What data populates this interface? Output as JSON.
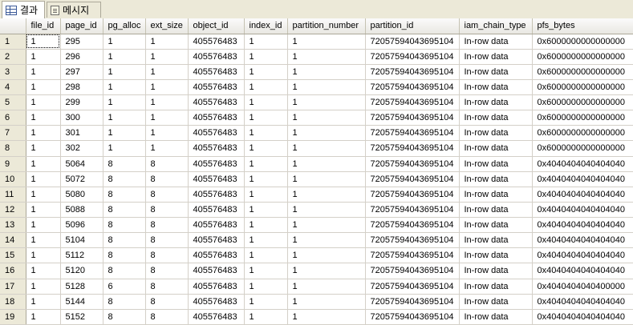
{
  "tabs": [
    {
      "label": "결과",
      "icon": "grid-icon",
      "active": true
    },
    {
      "label": "메시지",
      "icon": "message-doc-icon",
      "active": false
    }
  ],
  "columns": [
    "file_id",
    "page_id",
    "pg_alloc",
    "ext_size",
    "object_id",
    "index_id",
    "partition_number",
    "partition_id",
    "iam_chain_type",
    "pfs_bytes"
  ],
  "rows": [
    {
      "n": "1",
      "c": [
        "1",
        "295",
        "1",
        "1",
        "405576483",
        "1",
        "1",
        "72057594043695104",
        "In-row data",
        "0x6000000000000000"
      ]
    },
    {
      "n": "2",
      "c": [
        "1",
        "296",
        "1",
        "1",
        "405576483",
        "1",
        "1",
        "72057594043695104",
        "In-row data",
        "0x6000000000000000"
      ]
    },
    {
      "n": "3",
      "c": [
        "1",
        "297",
        "1",
        "1",
        "405576483",
        "1",
        "1",
        "72057594043695104",
        "In-row data",
        "0x6000000000000000"
      ]
    },
    {
      "n": "4",
      "c": [
        "1",
        "298",
        "1",
        "1",
        "405576483",
        "1",
        "1",
        "72057594043695104",
        "In-row data",
        "0x6000000000000000"
      ]
    },
    {
      "n": "5",
      "c": [
        "1",
        "299",
        "1",
        "1",
        "405576483",
        "1",
        "1",
        "72057594043695104",
        "In-row data",
        "0x6000000000000000"
      ]
    },
    {
      "n": "6",
      "c": [
        "1",
        "300",
        "1",
        "1",
        "405576483",
        "1",
        "1",
        "72057594043695104",
        "In-row data",
        "0x6000000000000000"
      ]
    },
    {
      "n": "7",
      "c": [
        "1",
        "301",
        "1",
        "1",
        "405576483",
        "1",
        "1",
        "72057594043695104",
        "In-row data",
        "0x6000000000000000"
      ]
    },
    {
      "n": "8",
      "c": [
        "1",
        "302",
        "1",
        "1",
        "405576483",
        "1",
        "1",
        "72057594043695104",
        "In-row data",
        "0x6000000000000000"
      ]
    },
    {
      "n": "9",
      "c": [
        "1",
        "5064",
        "8",
        "8",
        "405576483",
        "1",
        "1",
        "72057594043695104",
        "In-row data",
        "0x4040404040404040"
      ]
    },
    {
      "n": "10",
      "c": [
        "1",
        "5072",
        "8",
        "8",
        "405576483",
        "1",
        "1",
        "72057594043695104",
        "In-row data",
        "0x4040404040404040"
      ]
    },
    {
      "n": "11",
      "c": [
        "1",
        "5080",
        "8",
        "8",
        "405576483",
        "1",
        "1",
        "72057594043695104",
        "In-row data",
        "0x4040404040404040"
      ]
    },
    {
      "n": "12",
      "c": [
        "1",
        "5088",
        "8",
        "8",
        "405576483",
        "1",
        "1",
        "72057594043695104",
        "In-row data",
        "0x4040404040404040"
      ]
    },
    {
      "n": "13",
      "c": [
        "1",
        "5096",
        "8",
        "8",
        "405576483",
        "1",
        "1",
        "72057594043695104",
        "In-row data",
        "0x4040404040404040"
      ]
    },
    {
      "n": "14",
      "c": [
        "1",
        "5104",
        "8",
        "8",
        "405576483",
        "1",
        "1",
        "72057594043695104",
        "In-row data",
        "0x4040404040404040"
      ]
    },
    {
      "n": "15",
      "c": [
        "1",
        "5112",
        "8",
        "8",
        "405576483",
        "1",
        "1",
        "72057594043695104",
        "In-row data",
        "0x4040404040404040"
      ]
    },
    {
      "n": "16",
      "c": [
        "1",
        "5120",
        "8",
        "8",
        "405576483",
        "1",
        "1",
        "72057594043695104",
        "In-row data",
        "0x4040404040404040"
      ]
    },
    {
      "n": "17",
      "c": [
        "1",
        "5128",
        "6",
        "8",
        "405576483",
        "1",
        "1",
        "72057594043695104",
        "In-row data",
        "0x4040404040400000"
      ]
    },
    {
      "n": "18",
      "c": [
        "1",
        "5144",
        "8",
        "8",
        "405576483",
        "1",
        "1",
        "72057594043695104",
        "In-row data",
        "0x4040404040404040"
      ]
    },
    {
      "n": "19",
      "c": [
        "1",
        "5152",
        "8",
        "8",
        "405576483",
        "1",
        "1",
        "72057594043695104",
        "In-row data",
        "0x4040404040404040"
      ]
    }
  ]
}
